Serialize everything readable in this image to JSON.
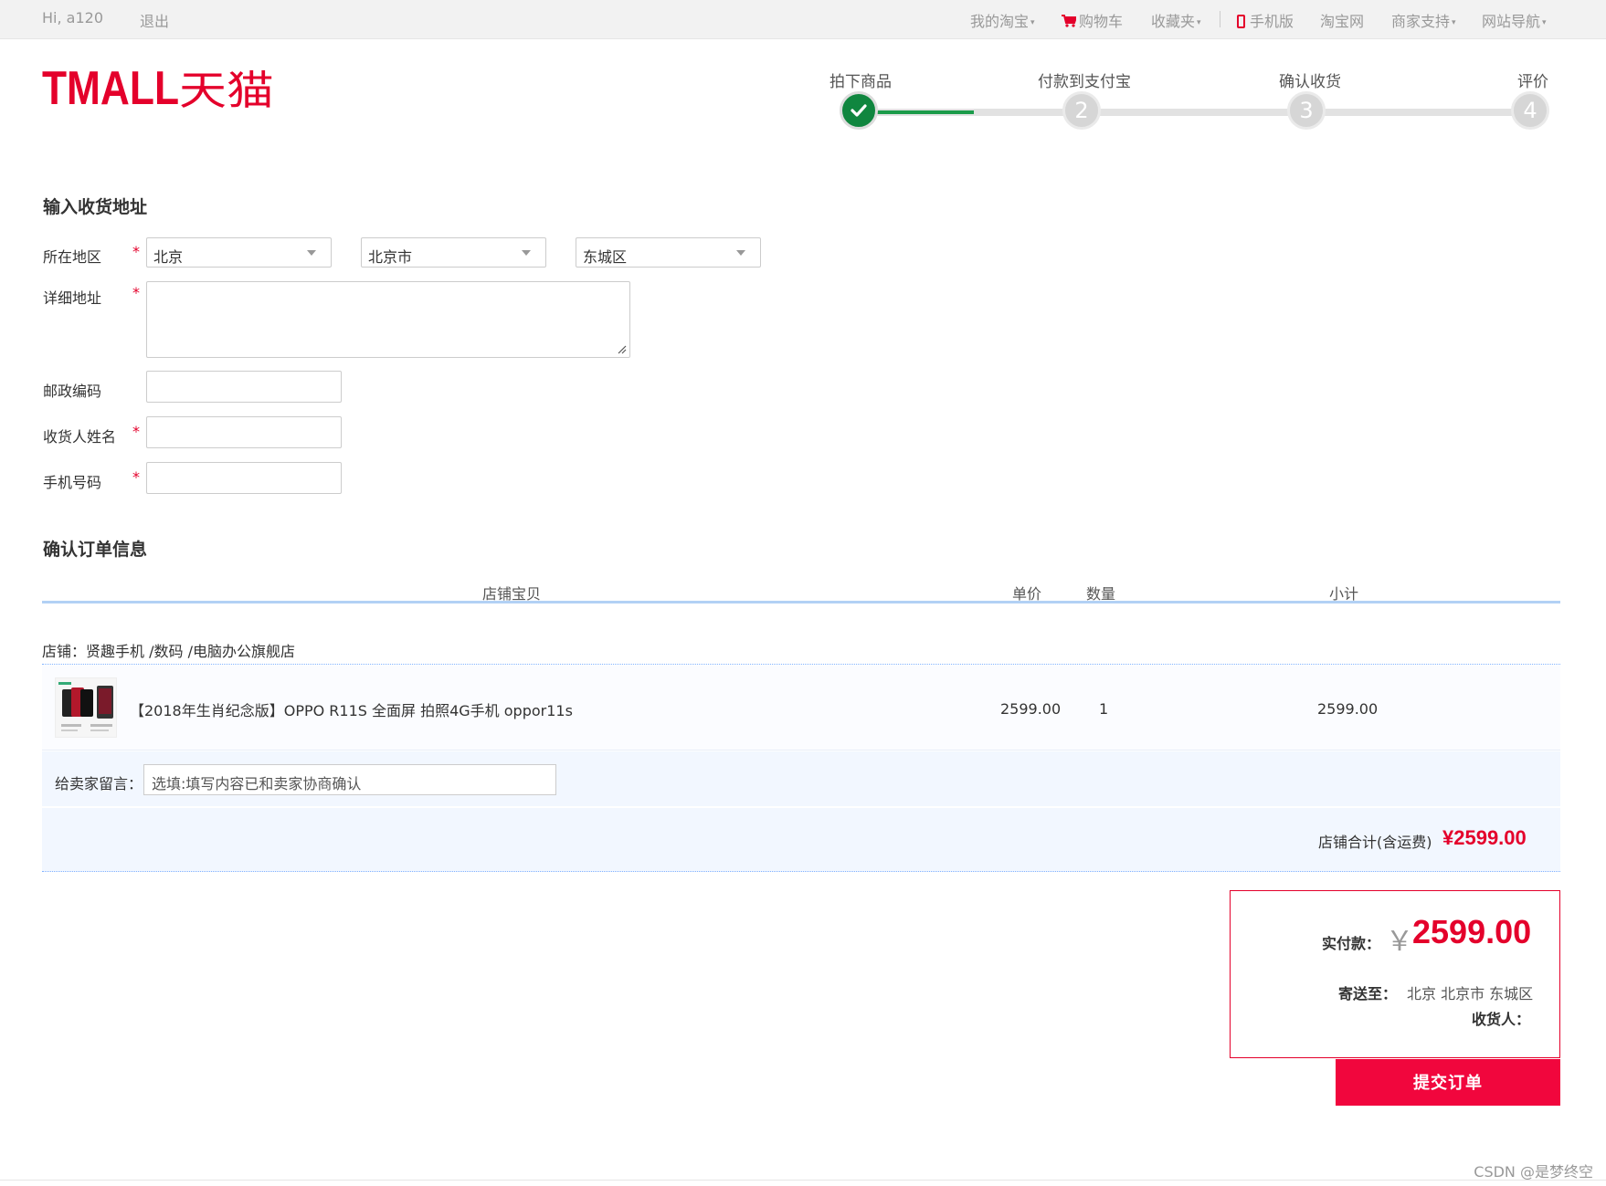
{
  "topbar": {
    "greeting": "Hi, a120",
    "logout": "退出",
    "nav": {
      "my_taobao": "我的淘宝",
      "cart": "购物车",
      "favorites": "收藏夹",
      "mobile": "手机版",
      "taobao": "淘宝网",
      "merchant_support": "商家支持",
      "site_nav": "网站导航"
    }
  },
  "logo": {
    "text": "TMALL天猫",
    "color": "#e4002b"
  },
  "steps": [
    {
      "label": "拍下商品",
      "number": "",
      "done": true
    },
    {
      "label": "付款到支付宝",
      "number": "2",
      "done": false
    },
    {
      "label": "确认收货",
      "number": "3",
      "done": false
    },
    {
      "label": "评价",
      "number": "4",
      "done": false
    }
  ],
  "address": {
    "title": "输入收货地址",
    "region_label": "所在地区",
    "province": "北京",
    "city": "北京市",
    "district": "东城区",
    "detail_label": "详细地址",
    "detail_value": "",
    "postcode_label": "邮政编码",
    "postcode_value": "",
    "receiver_label": "收货人姓名",
    "receiver_value": "",
    "phone_label": "手机号码",
    "phone_value": "",
    "required_mark": "*"
  },
  "order": {
    "title": "确认订单信息",
    "columns": {
      "item": "店铺宝贝",
      "price": "单价",
      "qty": "数量",
      "subtotal": "小计"
    },
    "shop_name": "店铺：贤趣手机 /数码 /电脑办公旗舰店",
    "items": [
      {
        "name": "【2018年生肖纪念版】OPPO R11S 全面屏 拍照4G手机 oppor11s",
        "price": "2599.00",
        "qty": "1",
        "subtotal": "2599.00"
      }
    ],
    "message_label": "给卖家留言：",
    "message_placeholder": "选填:填写内容已和卖家协商确认",
    "shop_total_label": "店铺合计(含运费)",
    "shop_total_value": "¥2599.00"
  },
  "summary": {
    "pay_label": "实付款：",
    "currency": "￥",
    "pay_value": "2599.00",
    "ship_label": "寄送至：",
    "ship_value": "北京 北京市 东城区",
    "receiver_label": "收货人："
  },
  "submit_button": "提交订单",
  "watermark": "CSDN @是梦终空",
  "colors": {
    "accent": "#e4002b",
    "step_done": "#10863f",
    "table_line": "#b2d1f5"
  }
}
